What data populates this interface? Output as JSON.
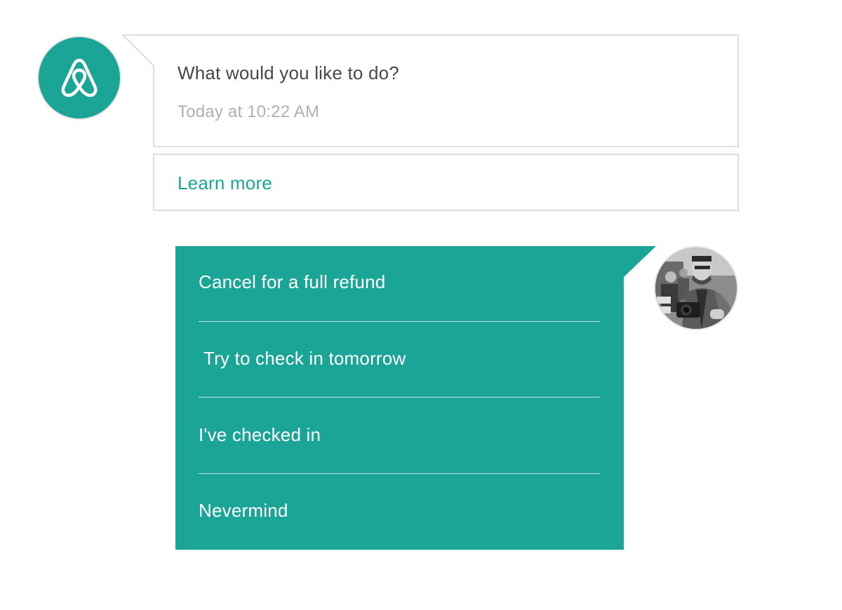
{
  "bot": {
    "avatar_icon": "airbnb-logo-icon",
    "message": "What would you like to do?",
    "timestamp": "Today at 10:22 AM",
    "learn_more": "Learn more"
  },
  "reply_options": [
    {
      "label": "Cancel for a full refund"
    },
    {
      "label": " Try to check in tomorrow"
    },
    {
      "label": "I've checked in"
    },
    {
      "label": "Nevermind"
    }
  ],
  "user": {
    "avatar_icon": "user-photo-avatar"
  },
  "colors": {
    "accent": "#1ba596",
    "text": "#484848",
    "muted": "#b0b0b0",
    "border": "#dedede",
    "option_text": "#ffffff"
  }
}
